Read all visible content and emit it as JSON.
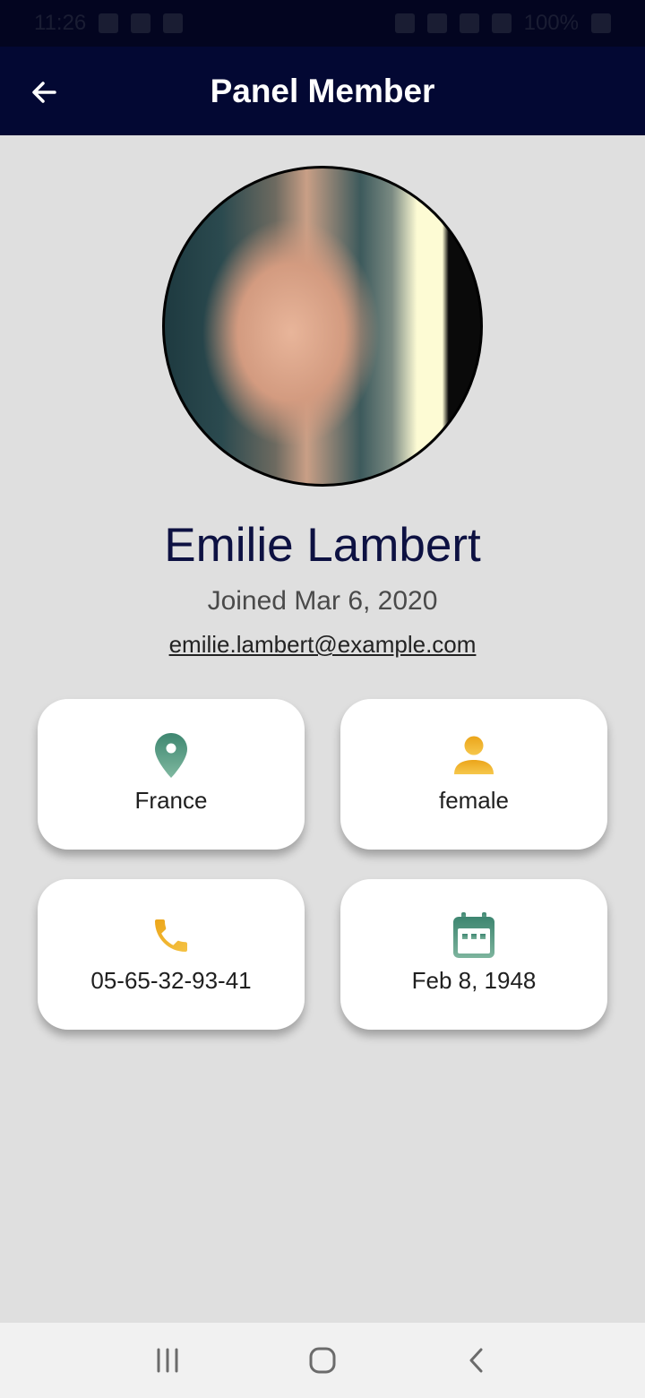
{
  "status_bar": {
    "time": "11:26",
    "battery": "100%"
  },
  "app_bar": {
    "title": "Panel Member"
  },
  "profile": {
    "name": "Emilie Lambert",
    "joined": "Joined Mar 6, 2020",
    "email": "emilie.lambert@example.com"
  },
  "cards": {
    "country": {
      "label": "France",
      "icon": "location-pin-icon"
    },
    "gender": {
      "label": "female",
      "icon": "person-icon"
    },
    "phone": {
      "label": "05-65-32-93-41",
      "icon": "phone-icon"
    },
    "birth_date": {
      "label": "Feb 8, 1948",
      "icon": "calendar-icon"
    }
  },
  "colors": {
    "app_bar": "#030833",
    "accent_green": "#3d8a70",
    "accent_gold": "#efb020",
    "name_text": "#0d1142"
  }
}
